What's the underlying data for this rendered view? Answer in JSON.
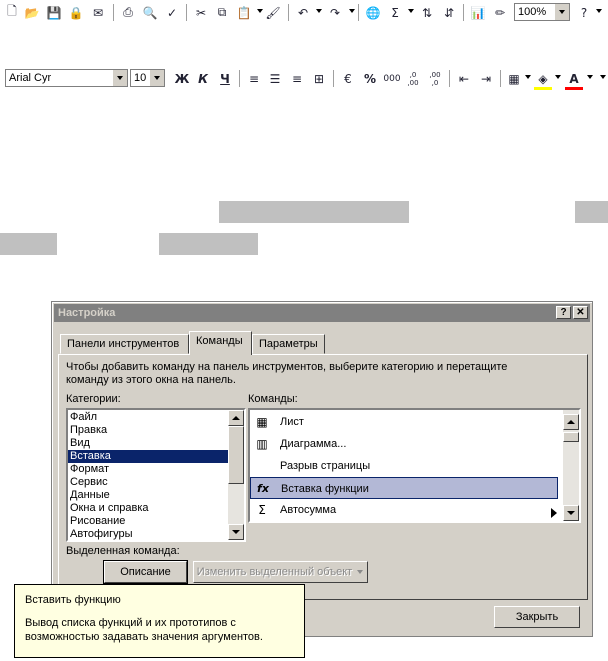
{
  "standard_toolbar": {
    "icons": [
      "new-icon",
      "open-icon",
      "save-icon",
      "permission-icon",
      "email-icon",
      "print-icon",
      "print-preview-icon",
      "spelling-icon",
      "cut-icon",
      "copy-icon",
      "paste-icon",
      "format-painter-icon",
      "undo-icon",
      "redo-icon",
      "hyperlink-icon",
      "autosum-icon",
      "sort-ascending-icon",
      "sort-descending-icon",
      "chart-wizard-icon",
      "drawing-icon",
      "help-icon"
    ],
    "zoom": "100%"
  },
  "formatting_toolbar": {
    "font": "Arial Cyr",
    "size": "10",
    "bold": "Ж",
    "italic": "К",
    "underline": "Ч",
    "percent": "%",
    "thousands": "000",
    "inc_decimal": ",0 ,00",
    "dec_decimal": ",00 ,0"
  },
  "dialog": {
    "title": "Настройка",
    "help_btn": "?",
    "close_btn": "✕",
    "tabs": [
      "Панели инструментов",
      "Команды",
      "Параметры"
    ],
    "active_tab": "Команды",
    "instruction": "Чтобы добавить команду на панель инструментов, выберите категорию и перетащите команду из этого окна на панель.",
    "categories_label": "Категории:",
    "commands_label": "Команды:",
    "categories": [
      "Файл",
      "Правка",
      "Вид",
      "Вставка",
      "Формат",
      "Сервис",
      "Данные",
      "Окна и справка",
      "Рисование",
      "Автофигуры"
    ],
    "selected_category": "Вставка",
    "commands": [
      {
        "icon": "sheet-icon",
        "glyph": "▦",
        "label": "Лист"
      },
      {
        "icon": "chart-icon",
        "glyph": "▥",
        "label": "Диаграмма..."
      },
      {
        "icon": "",
        "glyph": "",
        "label": "Разрыв страницы"
      },
      {
        "icon": "function-icon",
        "glyph": "fx",
        "label": "Вставка функции"
      },
      {
        "icon": "autosum-icon",
        "glyph": "Σ",
        "label": "Автосумма"
      }
    ],
    "selected_command": "Вставка функции",
    "selected_cmd_label": "Выделенная команда:",
    "description_btn": "Описание",
    "modify_btn": "Изменить выделенный объект",
    "close_button": "Закрыть"
  },
  "tooltip": {
    "title": "Вставить функцию",
    "body": "Вывод списка функций и их прототипов с возможностью задавать значения аргументов."
  }
}
